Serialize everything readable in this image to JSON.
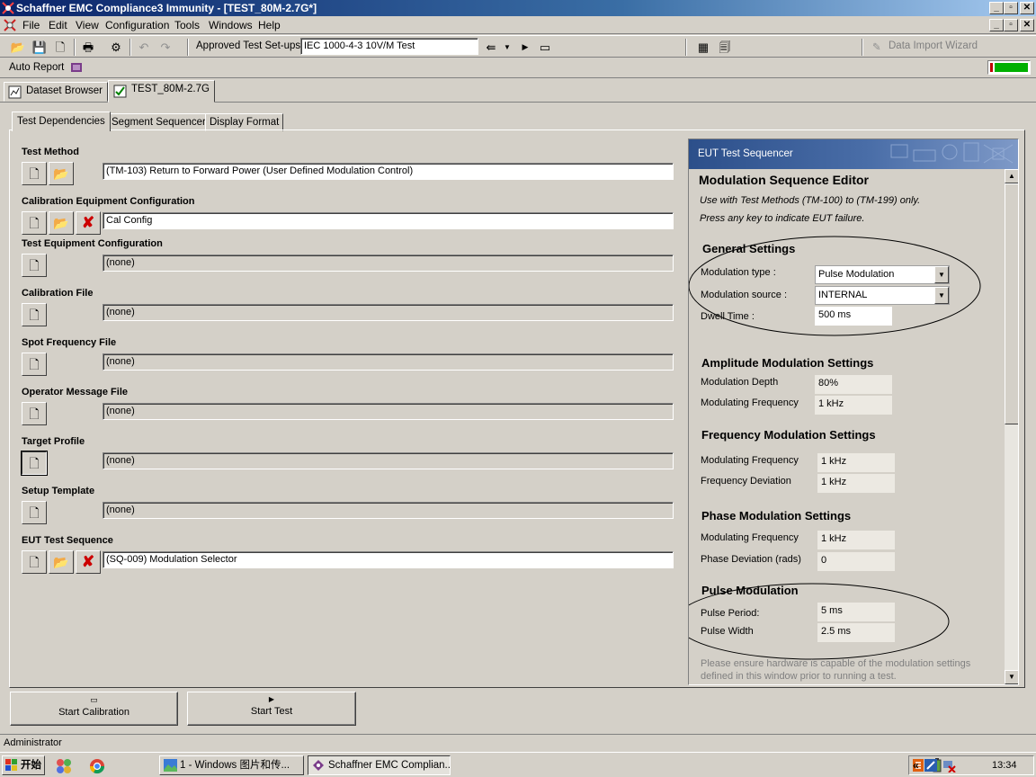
{
  "window": {
    "title": "Schaffner EMC Compliance3 Immunity - [TEST_80M-2.7G*]",
    "min_label": "_",
    "max_label": "▫",
    "close_label": "✕"
  },
  "menu": {
    "items": [
      "File",
      "Edit",
      "View",
      "Configuration",
      "Tools",
      "Windows",
      "Help"
    ]
  },
  "toolbar": {
    "approved_label": "Approved Test Set-ups",
    "approved_value": "IEC 1000-4-3 10V/M Test",
    "data_import_label": "Data Import Wizard"
  },
  "autobar": {
    "auto_report_label": "Auto Report"
  },
  "doc_tabs": [
    "Dataset Browser",
    "TEST_80M-2.7G"
  ],
  "sub_tabs": [
    "Test Dependencies",
    "Segment Sequencer",
    "Display Format"
  ],
  "sections": {
    "test_method": {
      "label": "Test Method",
      "value": "(TM-103) Return to Forward Power (User Defined Modulation Control)"
    },
    "cal_equipment": {
      "label": "Calibration Equipment Configuration",
      "value": "Cal Config"
    },
    "test_equipment": {
      "label": "Test Equipment Configuration",
      "value": "(none)"
    },
    "cal_file": {
      "label": "Calibration File",
      "value": "(none)"
    },
    "spot_freq": {
      "label": "Spot Frequency File",
      "value": "(none)"
    },
    "operator_msg": {
      "label": "Operator Message File",
      "value": "(none)"
    },
    "target_profile": {
      "label": "Target Profile",
      "value": "(none)"
    },
    "setup_template": {
      "label": "Setup Template",
      "value": "(none)"
    },
    "eut_sequence": {
      "label": "EUT Test Sequence",
      "value": "(SQ-009) Modulation Selector"
    }
  },
  "sequencer": {
    "header": "EUT Test Sequencer",
    "title": "Modulation Sequence Editor",
    "note1": "Use with Test Methods (TM-100) to (TM-199) only.",
    "note2": "Press any key to indicate EUT failure.",
    "general": {
      "heading": "General Settings",
      "mod_type_label": "Modulation type :",
      "mod_type_value": "Pulse Modulation",
      "mod_source_label": "Modulation source :",
      "mod_source_value": "INTERNAL",
      "dwell_label": "Dwell Time :",
      "dwell_value": "500 ms"
    },
    "amplitude": {
      "heading": "Amplitude Modulation Settings",
      "depth_label": "Modulation Depth",
      "depth_value": "80%",
      "freq_label": "Modulating Frequency",
      "freq_value": "1 kHz"
    },
    "frequency": {
      "heading": "Frequency Modulation Settings",
      "freq_label": "Modulating Frequency",
      "freq_value": "1 kHz",
      "dev_label": "Frequency Deviation",
      "dev_value": "1 kHz"
    },
    "phase": {
      "heading": "Phase Modulation Settings",
      "freq_label": "Modulating Frequency",
      "freq_value": "1 kHz",
      "dev_label": "Phase Deviation (rads)",
      "dev_value": "0"
    },
    "pulse": {
      "heading": "Pulse Modulation",
      "period_label": "Pulse Period:",
      "period_value": "5 ms",
      "width_label": "Pulse Width",
      "width_value": "2.5 ms"
    },
    "footer1": "Please ensure hardware is capable of the modulation settings",
    "footer2": "defined in this window prior to running a test."
  },
  "actions": {
    "start_calibration": "Start Calibration",
    "start_test": "Start Test"
  },
  "status": {
    "user": "Administrator"
  },
  "taskbar": {
    "start_label": "开始",
    "task1": "1 - Windows 图片和传...",
    "task2": "Schaffner EMC Complian...",
    "clock": "13:34"
  },
  "colors": {
    "titlebar": "#0a246a",
    "face": "#d4d0c8",
    "seq_header": "#2c4f8a",
    "delete_red": "#cc0000",
    "progress_green": "#00b000"
  }
}
